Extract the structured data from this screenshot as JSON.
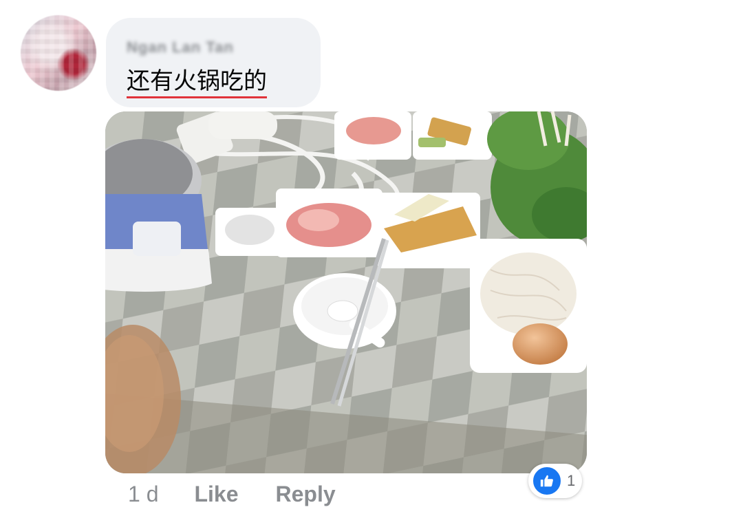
{
  "comment": {
    "author": "Ngan Lan Tan",
    "text": "还有火锅吃的"
  },
  "photo": {
    "alt_icon": "food-photo"
  },
  "actions": {
    "time": "1 d",
    "like_label": "Like",
    "reply_label": "Reply"
  },
  "reactions": {
    "icon": "thumbs-up-icon",
    "count": "1",
    "color": "#1877f2"
  }
}
